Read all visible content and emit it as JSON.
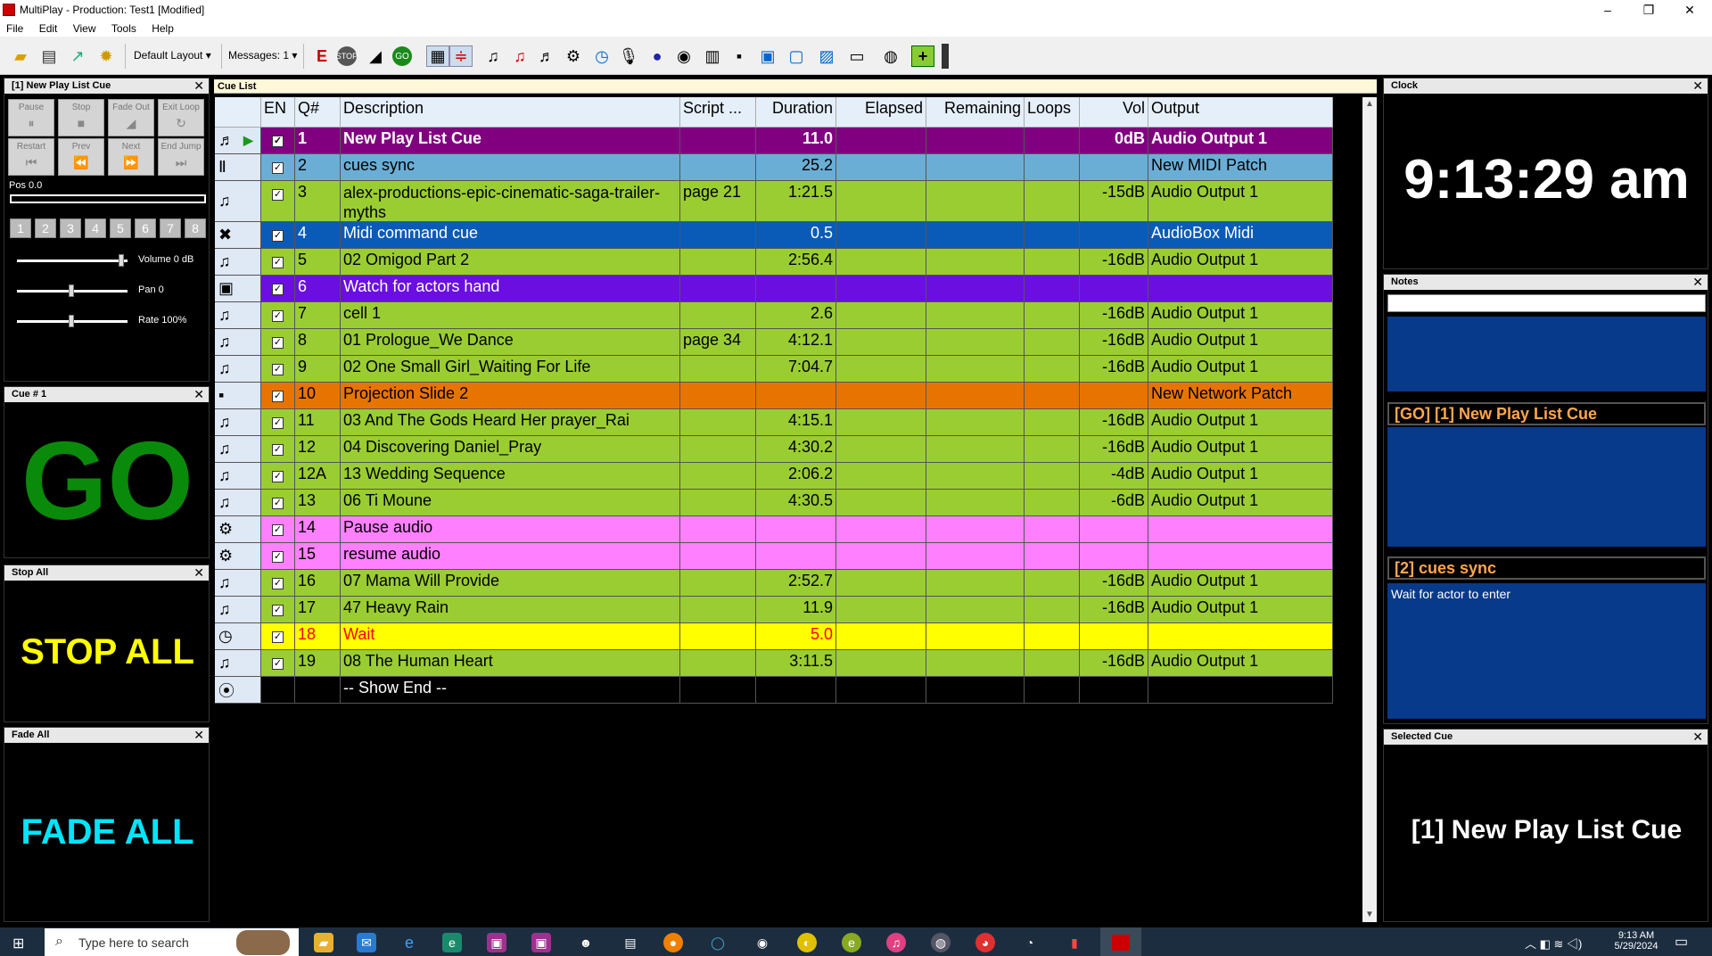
{
  "titlebar": {
    "title": "MultiPlay - Production: Test1 [Modified]",
    "min": "–",
    "restore": "❐",
    "close": "✕"
  },
  "menu": [
    "File",
    "Edit",
    "View",
    "Tools",
    "Help"
  ],
  "toolbar": {
    "layout_label": "Default Layout",
    "messages_label": "Messages: 1"
  },
  "controls": {
    "title": "[1] New Play List Cue",
    "buttons": [
      "Pause",
      "Stop",
      "Fade Out",
      "Exit Loop",
      "Restart",
      "Prev",
      "Next",
      "End Jump"
    ],
    "pos": "Pos 0.0",
    "numbers": [
      "1",
      "2",
      "3",
      "4",
      "5",
      "6",
      "7",
      "8"
    ],
    "volume": "Volume 0 dB",
    "pan": "Pan 0",
    "rate": "Rate 100%"
  },
  "cue_panel": {
    "title": "Cue # 1",
    "text": "GO"
  },
  "stop_panel": {
    "title": "Stop All",
    "text": "STOP ALL"
  },
  "fade_panel": {
    "title": "Fade All",
    "text": "FADE ALL"
  },
  "cuelist": {
    "title": "Cue List",
    "columns": [
      "EN",
      "Q#",
      "Description",
      "Script ...",
      "Duration",
      "Elapsed",
      "Remaining",
      "Loops",
      "Vol",
      "Output"
    ],
    "rows": [
      {
        "icon": "♬",
        "q": "1",
        "desc": "New Play List Cue",
        "script": "",
        "dur": "11.0",
        "vol": "0dB",
        "out": "Audio Output 1",
        "bg": "#800080",
        "fg": "#ffffff",
        "bold": true
      },
      {
        "icon": "Ⅱ",
        "q": "2",
        "desc": "cues sync",
        "script": "",
        "dur": "25.2",
        "vol": "",
        "out": "New MIDI Patch",
        "bg": "#6aaed6",
        "fg": "#000000"
      },
      {
        "icon": "♫",
        "q": "3",
        "desc": "alex-productions-epic-cinematic-saga-trailer-myths",
        "script": "page 21",
        "dur": "1:21.5",
        "vol": "-15dB",
        "out": "Audio Output 1",
        "bg": "#9acd32",
        "fg": "#000000",
        "tall": true
      },
      {
        "icon": "✖",
        "q": "4",
        "desc": "Midi command cue",
        "script": "",
        "dur": "0.5",
        "vol": "",
        "out": "AudioBox Midi",
        "bg": "#0a5bb8",
        "fg": "#ffffff"
      },
      {
        "icon": "♫",
        "q": "5",
        "desc": "02 Omigod Part 2",
        "script": "",
        "dur": "2:56.4",
        "vol": "-16dB",
        "out": "Audio Output 1",
        "bg": "#9acd32",
        "fg": "#000000"
      },
      {
        "icon": "▣",
        "q": "6",
        "desc": "Watch for actors hand",
        "script": "",
        "dur": "",
        "vol": "",
        "out": "",
        "bg": "#6a0fe0",
        "fg": "#ffffff"
      },
      {
        "icon": "♫",
        "q": "7",
        "desc": "cell 1",
        "script": "",
        "dur": "2.6",
        "vol": "-16dB",
        "out": "Audio Output 1",
        "bg": "#9acd32",
        "fg": "#000000"
      },
      {
        "icon": "♫",
        "q": "8",
        "desc": "01 Prologue_We Dance",
        "script": "page 34",
        "dur": "4:12.1",
        "vol": "-16dB",
        "out": "Audio Output 1",
        "bg": "#9acd32",
        "fg": "#000000"
      },
      {
        "icon": "♫",
        "q": "9",
        "desc": "02 One Small Girl_Waiting For Life",
        "script": "",
        "dur": "7:04.7",
        "vol": "-16dB",
        "out": "Audio Output 1",
        "bg": "#9acd32",
        "fg": "#000000"
      },
      {
        "icon": "▪",
        "q": "10",
        "desc": "Projection Slide 2",
        "script": "",
        "dur": "",
        "vol": "",
        "out": "New Network Patch",
        "bg": "#e87400",
        "fg": "#000000"
      },
      {
        "icon": "♫",
        "q": "11",
        "desc": "03 And The Gods Heard Her prayer_Rai",
        "script": "",
        "dur": "4:15.1",
        "vol": "-16dB",
        "out": "Audio Output 1",
        "bg": "#9acd32",
        "fg": "#000000"
      },
      {
        "icon": "♫",
        "q": "12",
        "desc": "04 Discovering Daniel_Pray",
        "script": "",
        "dur": "4:30.2",
        "vol": "-16dB",
        "out": "Audio Output 1",
        "bg": "#9acd32",
        "fg": "#000000"
      },
      {
        "icon": "♫",
        "q": "12A",
        "desc": "13 Wedding Sequence",
        "script": "",
        "dur": "2:06.2",
        "vol": "-4dB",
        "out": "Audio Output 1",
        "bg": "#9acd32",
        "fg": "#000000"
      },
      {
        "icon": "♫",
        "q": "13",
        "desc": "06 Ti Moune",
        "script": "",
        "dur": "4:30.5",
        "vol": "-6dB",
        "out": "Audio Output 1",
        "bg": "#9acd32",
        "fg": "#000000"
      },
      {
        "icon": "⚙",
        "q": "14",
        "desc": "Pause audio",
        "script": "",
        "dur": "",
        "vol": "",
        "out": "",
        "bg": "#ff80ff",
        "fg": "#000000"
      },
      {
        "icon": "⚙",
        "q": "15",
        "desc": "resume audio",
        "script": "",
        "dur": "",
        "vol": "",
        "out": "",
        "bg": "#ff80ff",
        "fg": "#000000"
      },
      {
        "icon": "♫",
        "q": "16",
        "desc": "07 Mama Will Provide",
        "script": "",
        "dur": "2:52.7",
        "vol": "-16dB",
        "out": "Audio Output 1",
        "bg": "#9acd32",
        "fg": "#000000"
      },
      {
        "icon": "♫",
        "q": "17",
        "desc": "47 Heavy Rain",
        "script": "",
        "dur": "11.9",
        "vol": "-16dB",
        "out": "Audio Output 1",
        "bg": "#9acd32",
        "fg": "#000000"
      },
      {
        "icon": "◷",
        "q": "18",
        "desc": "Wait",
        "script": "",
        "dur": "5.0",
        "vol": "",
        "out": "",
        "bg": "#ffff00",
        "fg": "#ff0000"
      },
      {
        "icon": "♫",
        "q": "19",
        "desc": "08 The Human Heart",
        "script": "",
        "dur": "3:11.5",
        "vol": "-16dB",
        "out": "Audio Output 1",
        "bg": "#9acd32",
        "fg": "#000000"
      },
      {
        "icon": "⦿",
        "q": "",
        "desc": "-- Show End --",
        "script": "",
        "dur": "",
        "vol": "",
        "out": "",
        "bg": "#000000",
        "fg": "#ffffff",
        "noCheck": true
      }
    ]
  },
  "clock": {
    "title": "Clock",
    "time": "9:13:29 am"
  },
  "notes": {
    "title": "Notes",
    "go_label": "[GO] [1] New Play List Cue",
    "next_label": "[2] cues sync",
    "next_note": "Wait for actor to enter"
  },
  "selected": {
    "title": "Selected Cue",
    "text": "[1] New Play List Cue"
  },
  "taskbar": {
    "search_placeholder": "Type here to search",
    "time": "9:13 AM",
    "date": "5/29/2024"
  }
}
